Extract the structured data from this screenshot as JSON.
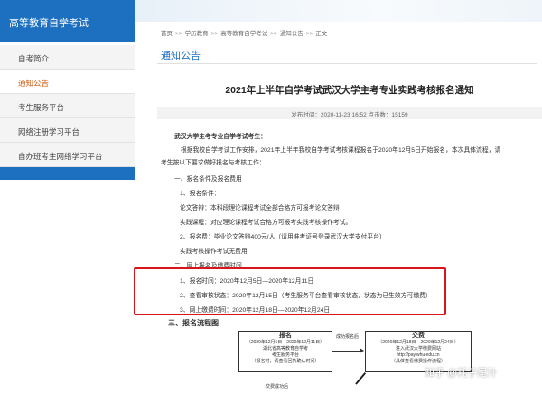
{
  "sidebar": {
    "header": "高等教育自学考试",
    "items": [
      {
        "label": "自考简介",
        "active": false
      },
      {
        "label": "通知公告",
        "active": true
      },
      {
        "label": "考生服务平台",
        "active": false
      },
      {
        "label": "网络注册学习平台",
        "active": false
      },
      {
        "label": "自办班考生网络学习平台",
        "active": false
      }
    ]
  },
  "breadcrumb": {
    "items": [
      "首页",
      "学历教育",
      "高等教育自学考试",
      "通知公告",
      "正文"
    ],
    "separator": ">>"
  },
  "section_title": "通知公告",
  "article": {
    "title": "2021年上半年自学考试武汉大学主考专业实践考核报名通知",
    "meta": "发布时间：2020-11-23 16:52    点击数：15159",
    "lines": {
      "greeting": "武汉大学主考专业自学考试考生：",
      "intro1": "根据我校自学考试工作安排，2021年上半年我校自学考试考核课程报名于2020年12月5日开始报名，本次具体流程，请",
      "intro2": "考生按以下要求做好报名与考核工作：",
      "h1": "一、报名条件及报名费用",
      "cond": "1、报名条件：",
      "cond_thesis": "论文答辩：本科段理论课程考试全部合格方可报考论文答辩",
      "cond_practice": "实践课程：对应理论课程考试合格方可报考实践考核操作考试。",
      "fee": "2、报名费：毕业论文答辩400元/人（请用准考证号登录武汉大学支付平台）",
      "fee_free": "实践考核操作考试无费用",
      "h2": "二、网上报名及缴费时间",
      "t1": "1、报名时间：2020年12月5日—2020年12月11日",
      "t2": "2、查看审核状态：2020年12月15日（考生服务平台查看审核状态，状态为已生效方可缴费）",
      "t3": "3、网上缴费时间：2020年12月18日—2020年12月24日",
      "h3": "三、报名流程图"
    }
  },
  "flow": {
    "box1_title": "报名",
    "box1_time": "（2020年12月5日—2020年12月11日）",
    "box1_l1": "湖北省高等教育自学考",
    "box1_l2": "考生服务平台",
    "box1_l3": "（报名时，请查看回执确认时间）",
    "arrow_label": "成功报名后",
    "box2_title": "交费",
    "box2_time": "（2020年12月18日—2020年12月24日）",
    "box2_l1": "进入武汉大学缴费网站",
    "box2_l2": "http://pay.whu.edu.cn",
    "box2_l3": "（具体查看缴费操作流程）",
    "bottom_label": "交费成功后"
  },
  "watermark": "知乎 @耗子尾汁",
  "colors": {
    "brand": "#1d6fbf",
    "active": "#d05a10",
    "highlight": "#d9141b"
  }
}
